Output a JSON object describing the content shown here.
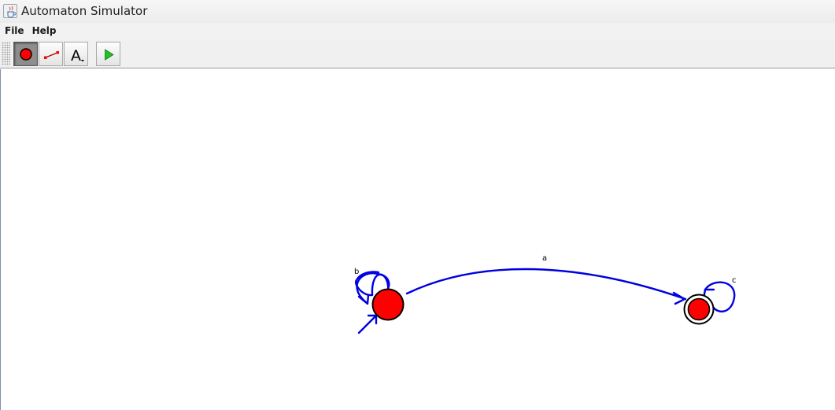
{
  "window": {
    "title": "Automaton Simulator",
    "app_icon": "java-cup-icon"
  },
  "menu": {
    "items": [
      {
        "label": "File"
      },
      {
        "label": "Help"
      }
    ]
  },
  "toolbar": {
    "tools": [
      {
        "name": "state-tool",
        "icon": "red-circle-icon",
        "selected": true
      },
      {
        "name": "transition-tool",
        "icon": "line-with-endpoints-icon",
        "selected": false
      },
      {
        "name": "text-tool",
        "icon": "text-A-dropdown-icon",
        "selected": false
      },
      {
        "name": "run-button",
        "icon": "play-icon",
        "selected": false
      }
    ]
  },
  "automaton": {
    "colors": {
      "state_fill": "#ff0000",
      "edge": "#0000e0",
      "outline": "#000000"
    },
    "states": [
      {
        "id": "q0",
        "initial": true,
        "accepting": false
      },
      {
        "id": "q1",
        "initial": false,
        "accepting": true
      }
    ],
    "transitions": [
      {
        "from": "q0",
        "to": "q0",
        "label": "b"
      },
      {
        "from": "q0",
        "to": "q1",
        "label": "a"
      },
      {
        "from": "q1",
        "to": "q1",
        "label": "c"
      }
    ]
  }
}
